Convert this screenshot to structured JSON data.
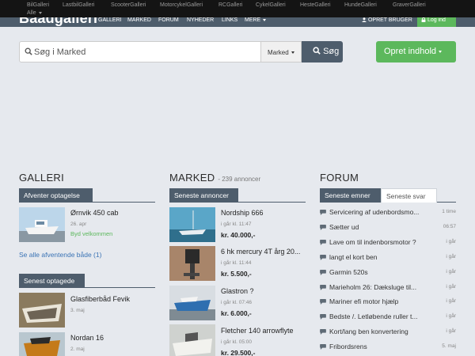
{
  "top_links": [
    "BilGalleri",
    "LastbilGalleri",
    "ScooterGalleri",
    "MotorcykelGalleri",
    "RCGalleri",
    "CykelGalleri",
    "HesteGalleri",
    "HundeGalleri",
    "GraverGalleri",
    "Alle"
  ],
  "brand": "Baadgalleri",
  "nav": {
    "items": [
      "GALLERI",
      "MARKED",
      "FORUM",
      "NYHEDER",
      "LINKS",
      "MERE"
    ],
    "register": "OPRET BRUGER",
    "login": "Log ind"
  },
  "search": {
    "placeholder": "Søg i Marked",
    "value": "",
    "category": "Marked",
    "button": "Søg"
  },
  "create_button": "Opret indhold",
  "galleri": {
    "title": "GALLERI",
    "pending": {
      "tab": "Afventer optagelse",
      "items": [
        {
          "title": "Ørnvik 450 cab",
          "date": "26. apr",
          "note": "Byd velkommen"
        }
      ],
      "see_all": "Se alle afventende både (1)"
    },
    "latest": {
      "tab": "Senest optagede",
      "items": [
        {
          "title": "Glasfiberbåd Fevik",
          "date": "3. maj"
        },
        {
          "title": "Nordan 16",
          "date": "2. maj"
        }
      ]
    }
  },
  "marked": {
    "title": "MARKED",
    "subtitle": "- 239 annoncer",
    "tab": "Seneste annoncer",
    "items": [
      {
        "title": "Nordship 666",
        "time": "i går kl. 11:47",
        "price": "kr. 40.000,-"
      },
      {
        "title": "6 hk mercury 4T årg 20...",
        "time": "i går kl. 11:44",
        "price": "kr. 5.500,-"
      },
      {
        "title": "Glastron ?",
        "time": "i går kl. 07:46",
        "price": "kr. 6.000,-"
      },
      {
        "title": "Fletcher 140 arrowflyte",
        "time": "i går kl. 05:00",
        "price": "kr. 29.500,-"
      }
    ]
  },
  "forum": {
    "title": "FORUM",
    "tabs": [
      "Seneste emner",
      "Seneste svar"
    ],
    "items": [
      {
        "title": "Servicering af udenbordsmo...",
        "time": "1 time"
      },
      {
        "title": "Sætter ud",
        "time": "06:57"
      },
      {
        "title": "Lave om til indenborsmotor ?",
        "time": "i går"
      },
      {
        "title": "langt el kort ben",
        "time": "i går"
      },
      {
        "title": "Garmin 520s",
        "time": "i går"
      },
      {
        "title": "Marieholm 26: Dæksluge til...",
        "time": "i går"
      },
      {
        "title": "Mariner efi motor hjælp",
        "time": "i går"
      },
      {
        "title": "Bedste /. Letløbende ruller t...",
        "time": "i går"
      },
      {
        "title": "Kort/lang ben konvertering",
        "time": "i går"
      },
      {
        "title": "Fribordsrens",
        "time": "5. maj"
      }
    ]
  }
}
